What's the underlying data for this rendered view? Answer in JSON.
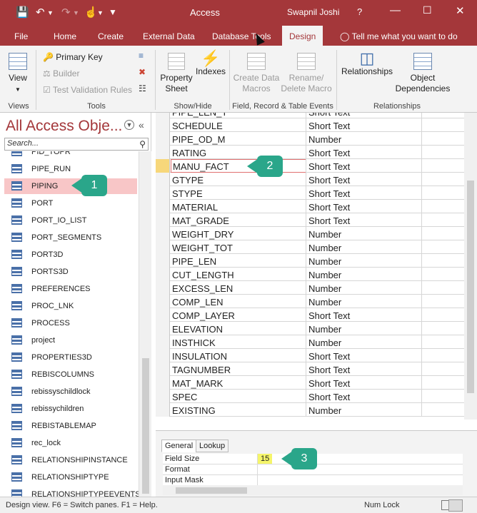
{
  "titlebar": {
    "app_title": "Access",
    "user": "Swapnil Joshi",
    "help": "?"
  },
  "qat": {
    "save_icon": "save-icon",
    "undo_icon": "undo-icon",
    "redo_icon": "redo-icon",
    "touch_icon": "touch-mode-icon"
  },
  "tabs": {
    "file": "File",
    "home": "Home",
    "create": "Create",
    "external": "External Data",
    "dbtools": "Database Tools",
    "design": "Design",
    "tellme": "Tell me what you want to do"
  },
  "ribbon": {
    "view": "View",
    "views_group": "Views",
    "primary_key": "Primary Key",
    "builder": "Builder",
    "test_rules": "Test Validation Rules",
    "tools_group": "Tools",
    "property_sheet": "Property Sheet",
    "indexes": "Indexes",
    "showhide_group": "Show/Hide",
    "create_data_macros": "Create Data Macros",
    "rename_delete_macro": "Rename/ Delete Macro",
    "field_events_group": "Field, Record & Table Events",
    "relationships": "Relationships",
    "object_dependencies": "Object Dependencies",
    "relationships_group": "Relationships"
  },
  "nav": {
    "title": "All Access Obje...",
    "search_placeholder": "Search...",
    "items": [
      "PID_TOPR",
      "PIPE_RUN",
      "PIPING",
      "PORT",
      "PORT_IO_LIST",
      "PORT_SEGMENTS",
      "PORT3D",
      "PORTS3D",
      "PREFERENCES",
      "PROC_LNK",
      "PROCESS",
      "project",
      "PROPERTIES3D",
      "REBISCOLUMNS",
      "rebissyschildlock",
      "rebissychildren",
      "REBISTABLEMAP",
      "rec_lock",
      "RELATIONSHIPINSTANCE",
      "RELATIONSHIPTYPE",
      "RELATIONSHIPTYPEEVENTS"
    ],
    "selected": "PIPING"
  },
  "fields": [
    {
      "name": "PIPE_LEN_T",
      "type": "Short Text"
    },
    {
      "name": "SCHEDULE",
      "type": "Short Text"
    },
    {
      "name": "PIPE_OD_M",
      "type": "Number"
    },
    {
      "name": "RATING",
      "type": "Short Text"
    },
    {
      "name": "MANU_FACT",
      "type": "Short Text"
    },
    {
      "name": "GTYPE",
      "type": "Short Text"
    },
    {
      "name": "STYPE",
      "type": "Short Text"
    },
    {
      "name": "MATERIAL",
      "type": "Short Text"
    },
    {
      "name": "MAT_GRADE",
      "type": "Short Text"
    },
    {
      "name": "WEIGHT_DRY",
      "type": "Number"
    },
    {
      "name": "WEIGHT_TOT",
      "type": "Number"
    },
    {
      "name": "PIPE_LEN",
      "type": "Number"
    },
    {
      "name": "CUT_LENGTH",
      "type": "Number"
    },
    {
      "name": "EXCESS_LEN",
      "type": "Number"
    },
    {
      "name": "COMP_LEN",
      "type": "Number"
    },
    {
      "name": "COMP_LAYER",
      "type": "Short Text"
    },
    {
      "name": "ELEVATION",
      "type": "Number"
    },
    {
      "name": "INSTHICK",
      "type": "Number"
    },
    {
      "name": "INSULATION",
      "type": "Short Text"
    },
    {
      "name": "TAGNUMBER",
      "type": "Short Text"
    },
    {
      "name": "MAT_MARK",
      "type": "Short Text"
    },
    {
      "name": "SPEC",
      "type": "Short Text"
    },
    {
      "name": "EXISTING",
      "type": "Number"
    }
  ],
  "current_field": "MANU_FACT",
  "properties": {
    "tab_general": "General",
    "tab_lookup": "Lookup",
    "rows": [
      {
        "label": "Field Size",
        "value": "15"
      },
      {
        "label": "Format",
        "value": ""
      },
      {
        "label": "Input Mask",
        "value": ""
      }
    ]
  },
  "status": {
    "left": "Design view.  F6 = Switch panes.  F1 = Help.",
    "numlock": "Num Lock"
  },
  "callouts": [
    "1",
    "2",
    "3"
  ],
  "colors": {
    "accent": "#a4373a",
    "selection": "#f8c6c7",
    "callout": "#2aa68a",
    "highlight": "#f5f56a"
  }
}
